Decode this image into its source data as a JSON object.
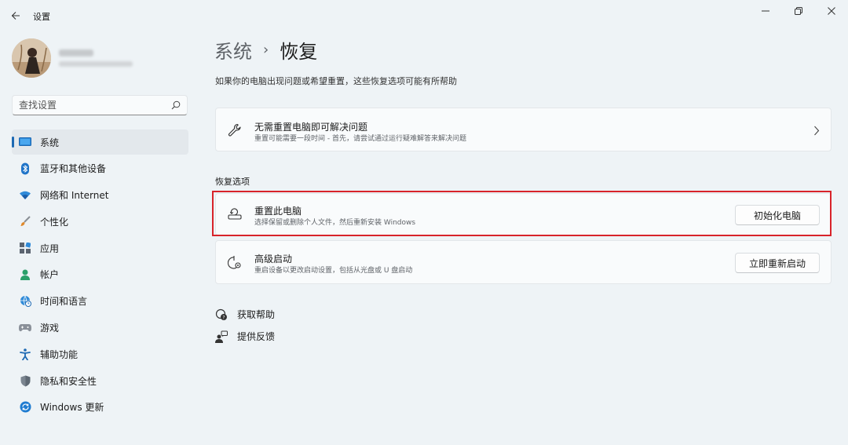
{
  "app": {
    "title": "设置"
  },
  "search": {
    "placeholder": "查找设置"
  },
  "sidebar": {
    "items": [
      {
        "label": "系统",
        "icon": "system-icon",
        "active": true
      },
      {
        "label": "蓝牙和其他设备",
        "icon": "bluetooth-icon"
      },
      {
        "label": "网络和 Internet",
        "icon": "wifi-icon"
      },
      {
        "label": "个性化",
        "icon": "brush-icon"
      },
      {
        "label": "应用",
        "icon": "apps-icon"
      },
      {
        "label": "帐户",
        "icon": "account-icon"
      },
      {
        "label": "时间和语言",
        "icon": "globe-clock-icon"
      },
      {
        "label": "游戏",
        "icon": "gamepad-icon"
      },
      {
        "label": "辅助功能",
        "icon": "accessibility-icon"
      },
      {
        "label": "隐私和安全性",
        "icon": "shield-icon"
      },
      {
        "label": "Windows 更新",
        "icon": "windows-update-icon"
      }
    ]
  },
  "main": {
    "breadcrumb_parent": "系统",
    "breadcrumb_sep": "›",
    "breadcrumb_current": "恢复",
    "description": "如果你的电脑出现问题或希望重置，这些恢复选项可能有所帮助",
    "troubleshoot": {
      "title": "无需重置电脑即可解决问题",
      "subtitle": "重置可能需要一段时间 - 首先，请尝试通过运行疑难解答来解决问题"
    },
    "section_title": "恢复选项",
    "reset": {
      "title": "重置此电脑",
      "subtitle": "选择保留或删除个人文件，然后重新安装 Windows",
      "button": "初始化电脑"
    },
    "advanced": {
      "title": "高级启动",
      "subtitle": "重启设备以更改启动设置，包括从光盘或 U 盘启动",
      "button": "立即重新启动"
    },
    "help_links": [
      {
        "label": "获取帮助",
        "icon": "help-icon"
      },
      {
        "label": "提供反馈",
        "icon": "feedback-icon"
      }
    ]
  },
  "colors": {
    "accent": "#1d69b3",
    "highlight": "#d8232a",
    "background": "#eef3f6"
  }
}
